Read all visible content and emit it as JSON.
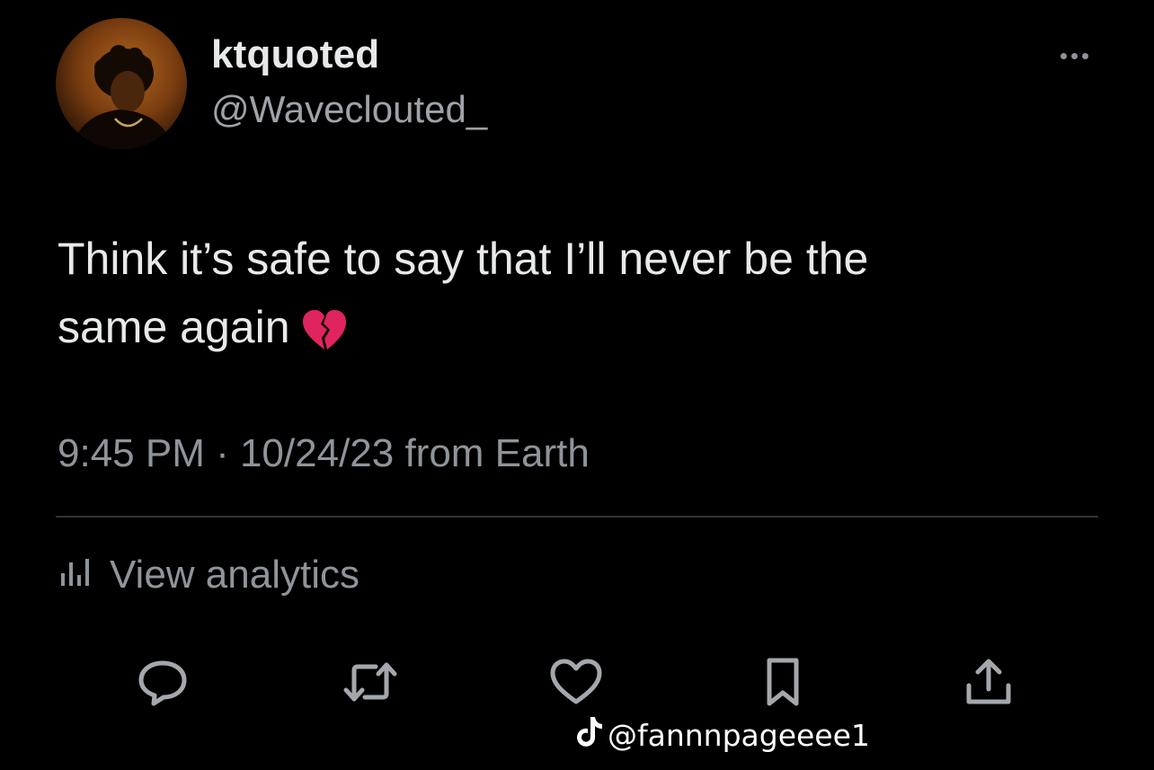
{
  "tweet": {
    "display_name": "ktquoted",
    "handle": "@Waveclouted_",
    "text_line_1": "Think it’s safe to say that I’ll never be the",
    "text_line_2": "same again",
    "emoji_icon": "broken-heart-icon",
    "meta": "9:45 PM · 10/24/23 from Earth"
  },
  "analytics": {
    "label": "View analytics",
    "icon": "bar-chart-icon"
  },
  "actions": [
    {
      "name": "reply",
      "icon": "reply-icon"
    },
    {
      "name": "retweet",
      "icon": "retweet-icon"
    },
    {
      "name": "like",
      "icon": "heart-icon"
    },
    {
      "name": "bookmark",
      "icon": "bookmark-icon"
    },
    {
      "name": "share",
      "icon": "share-icon"
    }
  ],
  "watermark": {
    "platform_icon": "tiktok-icon",
    "text": "@fannnpageeee1"
  },
  "colors": {
    "background": "#000000",
    "primary_text": "#e7e9ea",
    "secondary_text": "#8f949a",
    "divider": "#2f3336",
    "emoji": "#e0245e"
  }
}
